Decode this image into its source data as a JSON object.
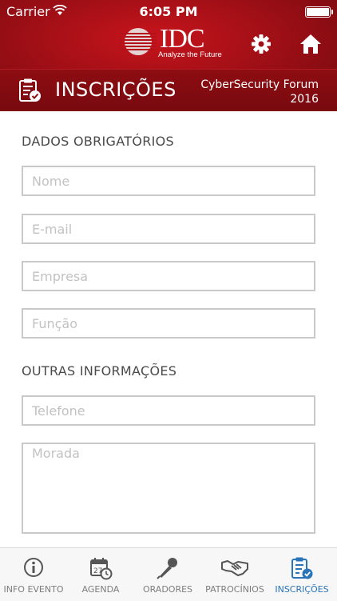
{
  "status": {
    "carrier": "Carrier",
    "time": "6:05 PM"
  },
  "header": {
    "logo_text": "IDC",
    "logo_tagline": "Analyze the Future",
    "section_title": "INSCRIÇÕES",
    "event_line1": "CyberSecurity Forum",
    "event_line2": "2016"
  },
  "form": {
    "required_title": "DADOS OBRIGATÓRIOS",
    "other_title": "OUTRAS INFORMAÇÕES",
    "name_placeholder": "Nome",
    "email_placeholder": "E-mail",
    "company_placeholder": "Empresa",
    "role_placeholder": "Função",
    "phone_placeholder": "Telefone",
    "address_placeholder": "Morada"
  },
  "tabs": [
    {
      "label": "INFO EVENTO",
      "icon": "info-icon"
    },
    {
      "label": "AGENDA",
      "icon": "calendar-icon"
    },
    {
      "label": "ORADORES",
      "icon": "microphone-icon"
    },
    {
      "label": "PATROCÍNIOS",
      "icon": "handshake-icon"
    },
    {
      "label": "INSCRIÇÕES",
      "icon": "registration-icon",
      "active": true
    }
  ],
  "colors": {
    "brand_red": "#a10f16",
    "active_tab": "#2a74b8"
  }
}
